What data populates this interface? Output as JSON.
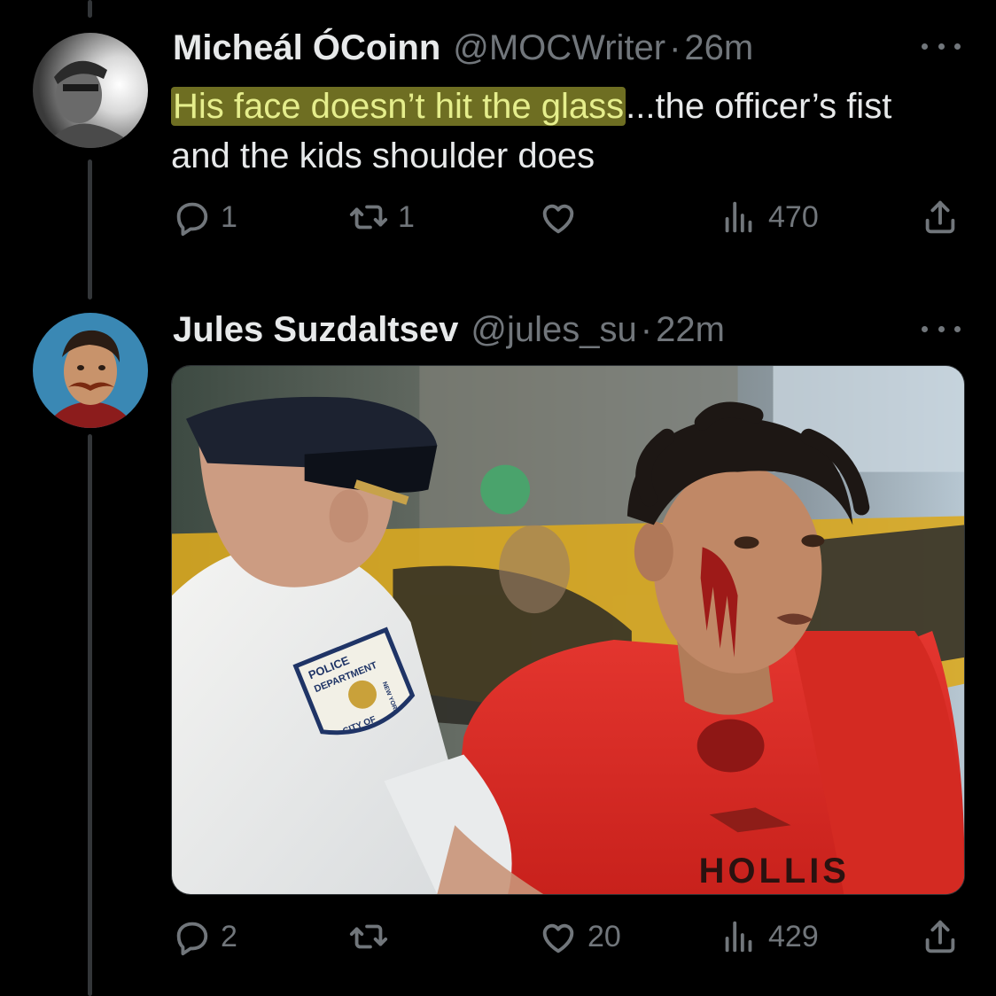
{
  "tweets": [
    {
      "author": "Micheál ÓCoinn",
      "handle": "@MOCWriter",
      "dot": "·",
      "time": "26m",
      "text_highlight": "His face doesn’t hit the glass",
      "text_rest": "...the officer’s fist and the kids shoulder does",
      "replies": "1",
      "retweets": "1",
      "likes": "",
      "views": "470"
    },
    {
      "author": "Jules Suzdaltsev",
      "handle": "@jules_su",
      "dot": "·",
      "time": "22m",
      "media": {
        "badge_top": "POLICE",
        "badge_mid": "DEPARTMENT",
        "badge_bottom": "CITY OF",
        "badge_side": "NEW YORK",
        "shirt_text": "HOLLIS"
      },
      "replies": "2",
      "retweets": "",
      "likes": "20",
      "views": "429"
    }
  ],
  "icons": [
    "more-icon",
    "reply-icon",
    "retweet-icon",
    "like-icon",
    "views-icon",
    "share-icon"
  ],
  "colors": {
    "background": "#000000",
    "text": "#e7e9ea",
    "muted": "#71767b",
    "highlight_bg": "#6e6e22",
    "highlight_text": "#e5ee8c"
  }
}
